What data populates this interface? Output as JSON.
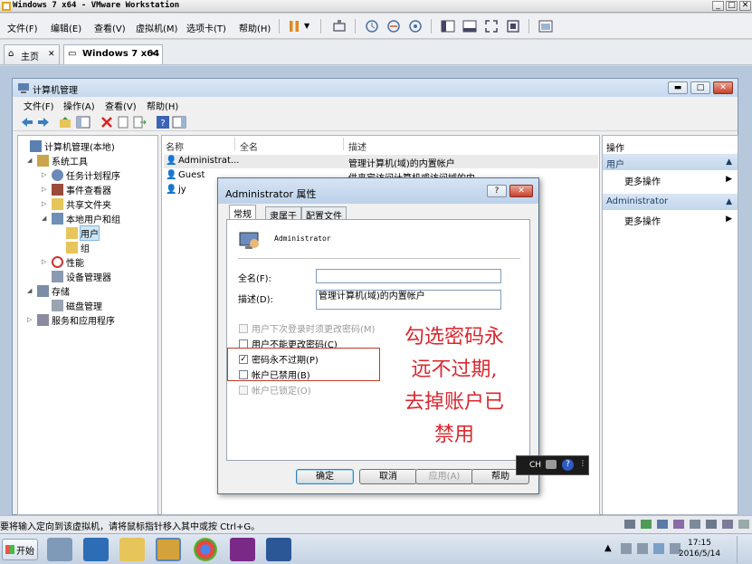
{
  "vmware": {
    "title": "Windows 7 x64 - VMware Workstation",
    "menu": [
      "文件(F)",
      "编辑(E)",
      "查看(V)",
      "虚拟机(M)",
      "选项卡(T)",
      "帮助(H)"
    ],
    "tabs": [
      {
        "label": "主页"
      },
      {
        "label": "Windows 7 x64"
      }
    ],
    "status_message": "要将输入定向到该虚拟机，请将鼠标指针移入其中或按 Ctrl+G。"
  },
  "cm": {
    "title": "计算机管理",
    "menu": [
      "文件(F)",
      "操作(A)",
      "查看(V)",
      "帮助(H)"
    ],
    "tree": [
      {
        "label": "计算机管理(本地)"
      },
      {
        "label": "系统工具"
      },
      {
        "label": "任务计划程序"
      },
      {
        "label": "事件查看器"
      },
      {
        "label": "共享文件夹"
      },
      {
        "label": "本地用户和组"
      },
      {
        "label": "用户"
      },
      {
        "label": "组"
      },
      {
        "label": "性能"
      },
      {
        "label": "设备管理器"
      },
      {
        "label": "存储"
      },
      {
        "label": "磁盘管理"
      },
      {
        "label": "服务和应用程序"
      }
    ],
    "columns": [
      "名称",
      "全名",
      "描述"
    ],
    "rows": [
      {
        "name": "Administrat...",
        "fullname": "",
        "desc": "管理计算机(域)的内置帐户"
      },
      {
        "name": "Guest",
        "fullname": "",
        "desc": "供来宾访问计算机或访问域的内..."
      },
      {
        "name": "jy",
        "fullname": "",
        "desc": ""
      }
    ],
    "actions": {
      "header": "操作",
      "sections": [
        {
          "title": "用户",
          "item": "更多操作"
        },
        {
          "title": "Administrator",
          "item": "更多操作"
        }
      ]
    }
  },
  "dialog": {
    "title": "Administrator 属性",
    "help_glyph": "?",
    "close_glyph": "✕",
    "tabs": [
      "常规",
      "隶属于",
      "配置文件"
    ],
    "username": "Administrator",
    "fullname_label": "全名(F):",
    "fullname_value": "",
    "desc_label": "描述(D):",
    "desc_value": "管理计算机(域)的内置帐户",
    "checkboxes": [
      {
        "label": "用户下次登录时须更改密码(M)",
        "checked": false,
        "disabled": true
      },
      {
        "label": "用户不能更改密码(C)",
        "checked": false,
        "disabled": false
      },
      {
        "label": "密码永不过期(P)",
        "checked": true,
        "disabled": false
      },
      {
        "label": "帐户已禁用(B)",
        "checked": false,
        "disabled": false
      },
      {
        "label": "帐户已锁定(O)",
        "checked": false,
        "disabled": true
      }
    ],
    "buttons": {
      "ok": "确定",
      "cancel": "取消",
      "apply": "应用(A)",
      "help": "帮助"
    }
  },
  "annotation": {
    "lines": [
      "勾选密码永",
      "远不过期,",
      "去掉账户已",
      "禁用"
    ],
    "color": "#d9282f"
  },
  "langbar": {
    "lang": "CH"
  },
  "taskbar": {
    "start_label": "开始",
    "time": "17:15",
    "date": "2016/5/14"
  }
}
